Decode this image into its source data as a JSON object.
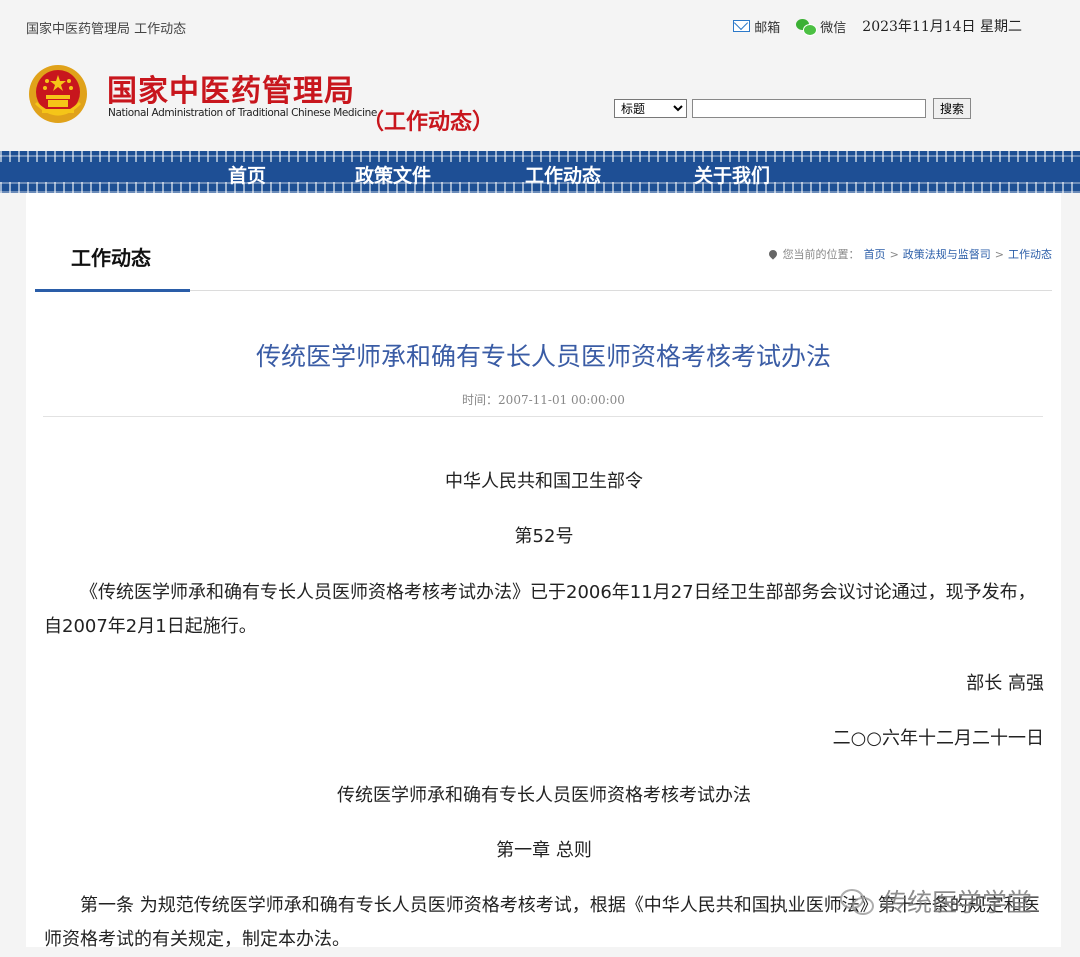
{
  "topbar": {
    "crumb": "国家中医药管理局 工作动态",
    "mail_label": "邮箱",
    "wechat_label": "微信",
    "date": "2023年11月14日 星期二"
  },
  "header": {
    "logo_cn": "国家中医药管理局",
    "logo_en": "National Administration of Traditional Chinese Medicine",
    "subtitle": "（工作动态）",
    "search_select": "标题",
    "search_placeholder": "",
    "search_button": "搜索"
  },
  "nav": {
    "items": [
      "首页",
      "政策文件",
      "工作动态",
      "关于我们"
    ]
  },
  "section": {
    "tab_title": "工作动态",
    "location_prefix": "您当前的位置：",
    "location_links": [
      "首页",
      "政策法规与监督司",
      "工作动态"
    ],
    "sep": ">"
  },
  "article": {
    "title": "传统医学师承和确有专长人员医师资格考核考试办法",
    "time": "时间：2007-11-01 00:00:00",
    "paragraphs": {
      "p1": "中华人民共和国卫生部令",
      "p2": "第52号",
      "p3": "《传统医学师承和确有专长人员医师资格考核考试办法》已于2006年11月27日经卫生部部务会议讨论通过，现予发布，自2007年2月1日起施行。",
      "p4": "部长 高强",
      "p5": "二○○六年十二月二十一日",
      "p6": "传统医学师承和确有专长人员医师资格考核考试办法",
      "p7": "第一章  总则",
      "p8": "第一条 为规范传统医学师承和确有专长人员医师资格考核考试，根据《中华人民共和国执业医师法》第十一条的规定和医师资格考试的有关规定，制定本办法。"
    }
  },
  "watermark": "传统医学学堂",
  "colors": {
    "brand_red": "#c8161d",
    "nav_blue": "#1e4f95",
    "title_blue": "#3a5ca5"
  }
}
